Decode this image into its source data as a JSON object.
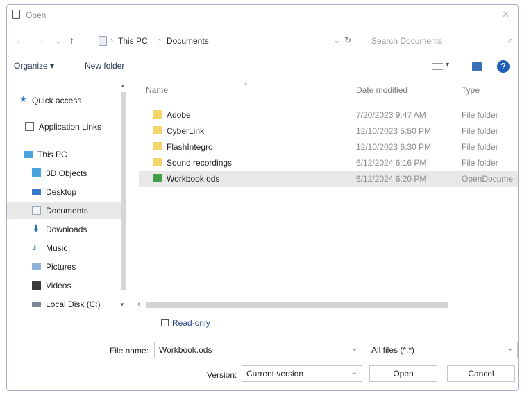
{
  "window": {
    "title": "Open"
  },
  "nav": {
    "back_icon": "arrow-left-icon",
    "forward_icon": "arrow-right-icon",
    "up_icon": "arrow-up-icon",
    "breadcrumb": [
      "This PC",
      "Documents"
    ],
    "search_placeholder": "Search Documents"
  },
  "toolbar": {
    "organize": "Organize ▾",
    "new_folder": "New folder"
  },
  "sidebar": {
    "items": [
      {
        "label": "Quick access",
        "icon": "star-icon"
      },
      {
        "label": "Application Links",
        "icon": "link-folder-icon"
      },
      {
        "label": "This PC",
        "icon": "computer-icon"
      },
      {
        "label": "3D Objects",
        "icon": "cube-icon"
      },
      {
        "label": "Desktop",
        "icon": "desktop-icon"
      },
      {
        "label": "Documents",
        "icon": "document-icon"
      },
      {
        "label": "Downloads",
        "icon": "download-icon"
      },
      {
        "label": "Music",
        "icon": "music-icon"
      },
      {
        "label": "Pictures",
        "icon": "pictures-icon"
      },
      {
        "label": "Videos",
        "icon": "video-icon"
      },
      {
        "label": "Local Disk (C:)",
        "icon": "disk-icon"
      }
    ]
  },
  "files": {
    "columns": [
      "Name",
      "Date modified",
      "Type"
    ],
    "rows": [
      {
        "name": "Adobe",
        "date": "7/20/2023 9:47 AM",
        "type": "File folder",
        "kind": "folder"
      },
      {
        "name": "CyberLink",
        "date": "12/10/2023 5:50 PM",
        "type": "File folder",
        "kind": "folder"
      },
      {
        "name": "FlashIntegro",
        "date": "12/10/2023 6:30 PM",
        "type": "File folder",
        "kind": "folder"
      },
      {
        "name": "Sound recordings",
        "date": "6/12/2024 6:16 PM",
        "type": "File folder",
        "kind": "folder"
      },
      {
        "name": "Workbook.ods",
        "date": "6/12/2024 6:20 PM",
        "type": "OpenDocume",
        "kind": "ods"
      }
    ]
  },
  "readonly": {
    "label": "Read-only",
    "checked": false
  },
  "footer": {
    "file_name_label": "File name:",
    "file_name_value": "Workbook.ods",
    "file_type_value": "All files (*.*)",
    "version_label": "Version:",
    "version_value": "Current version",
    "open_label": "Open",
    "cancel_label": "Cancel"
  },
  "colors": {
    "accent": "#2a4a88",
    "selection": "#e8e8e8",
    "frame": "#b8a6cf"
  }
}
